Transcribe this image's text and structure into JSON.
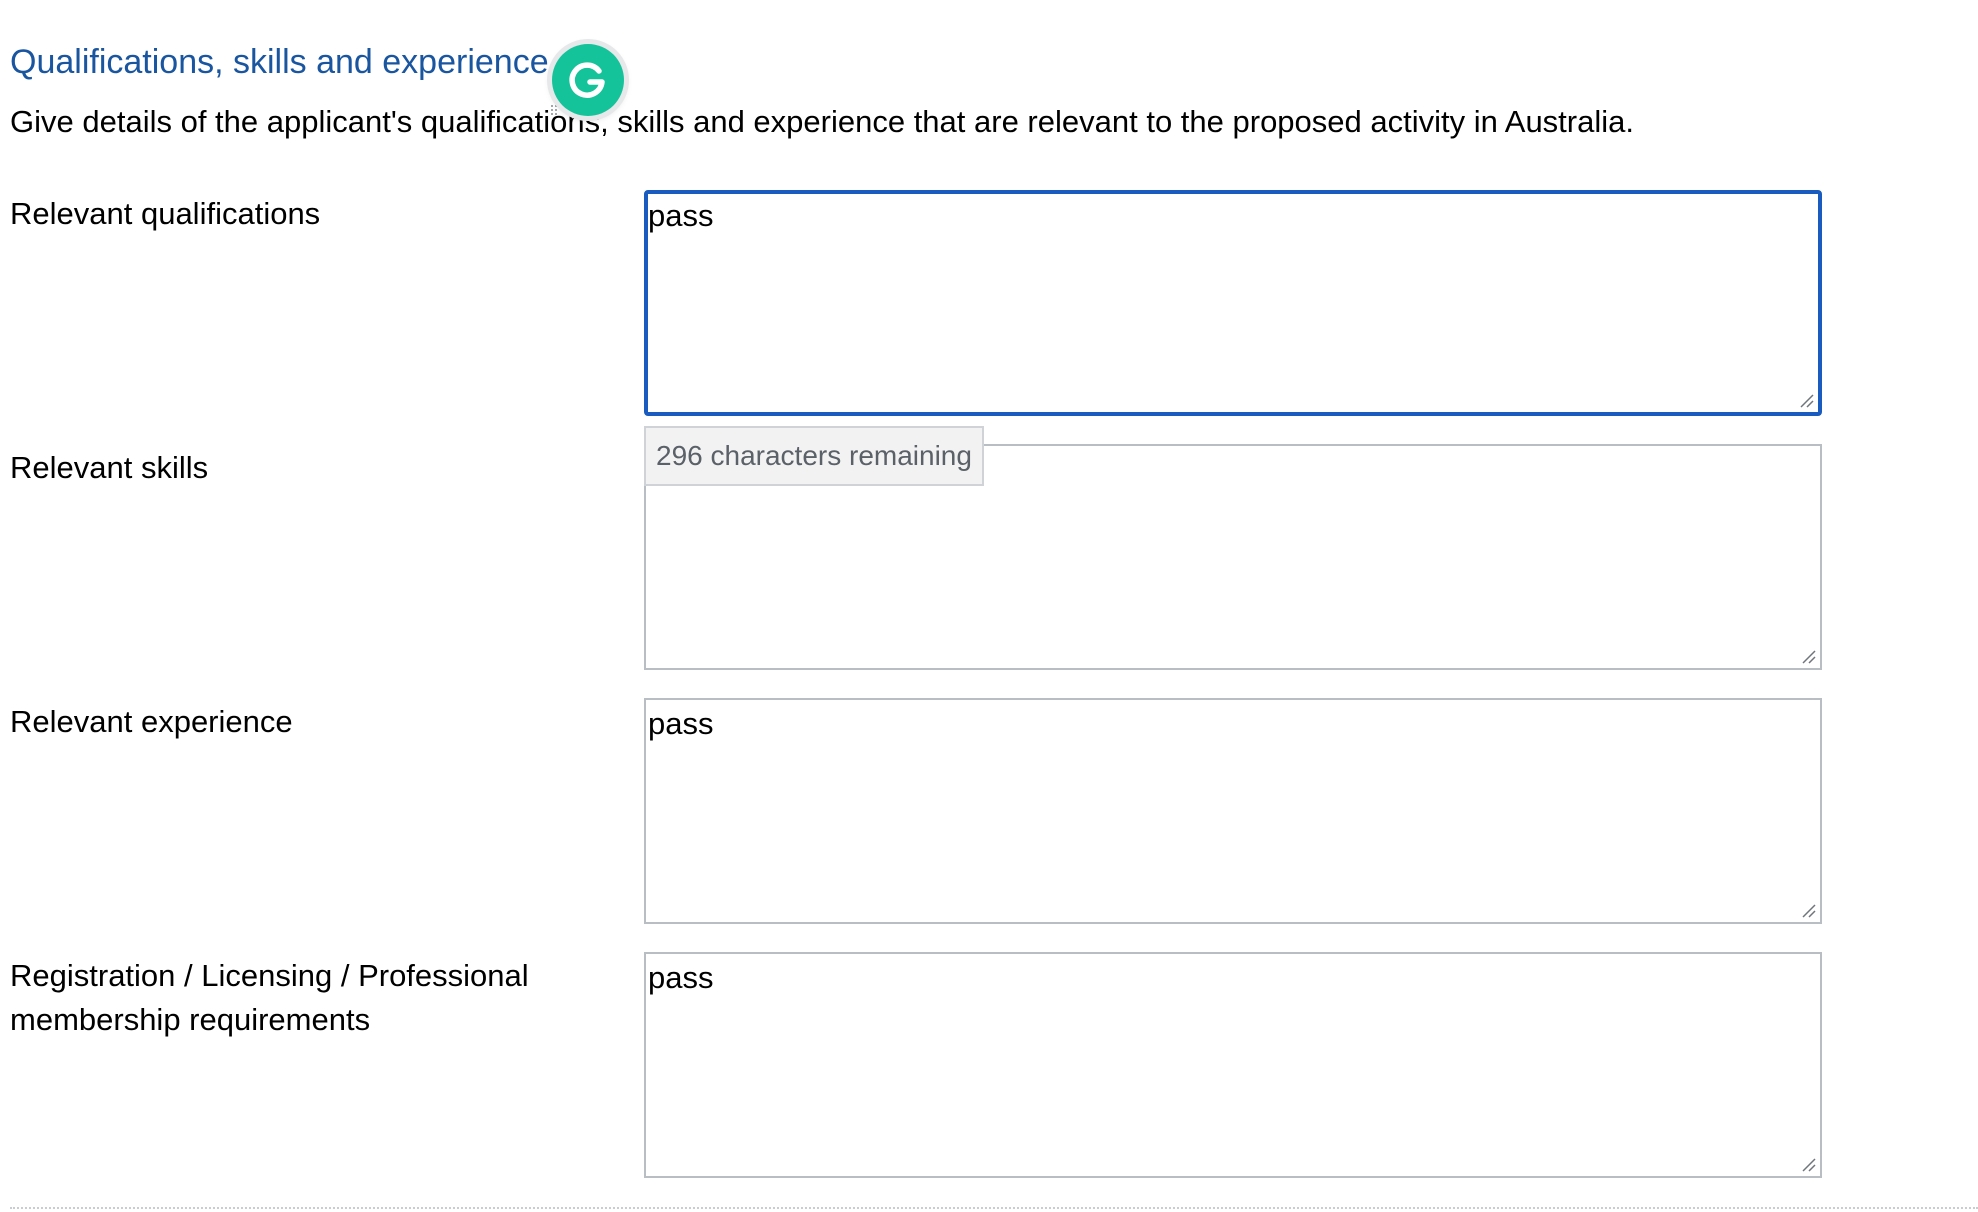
{
  "section": {
    "title": "Qualifications, skills and experience",
    "description": "Give details of the applicant's qualifications, skills and experience that are relevant to the proposed activity in Australia."
  },
  "fields": [
    {
      "label": "Relevant qualifications",
      "value": "pass",
      "focused": true
    },
    {
      "label": "Relevant skills",
      "value": ""
    },
    {
      "label": "Relevant experience",
      "value": "pass"
    },
    {
      "label": "Registration / Licensing / Professional membership requirements",
      "value": "pass"
    }
  ],
  "counter": {
    "text": "296 characters remaining"
  },
  "overlay": {
    "icon": "grammarly-icon"
  },
  "colors": {
    "title": "#1a56a0",
    "focus_border": "#1a5bbf",
    "border": "#b9bec5",
    "grammarly": "#15c39a"
  }
}
